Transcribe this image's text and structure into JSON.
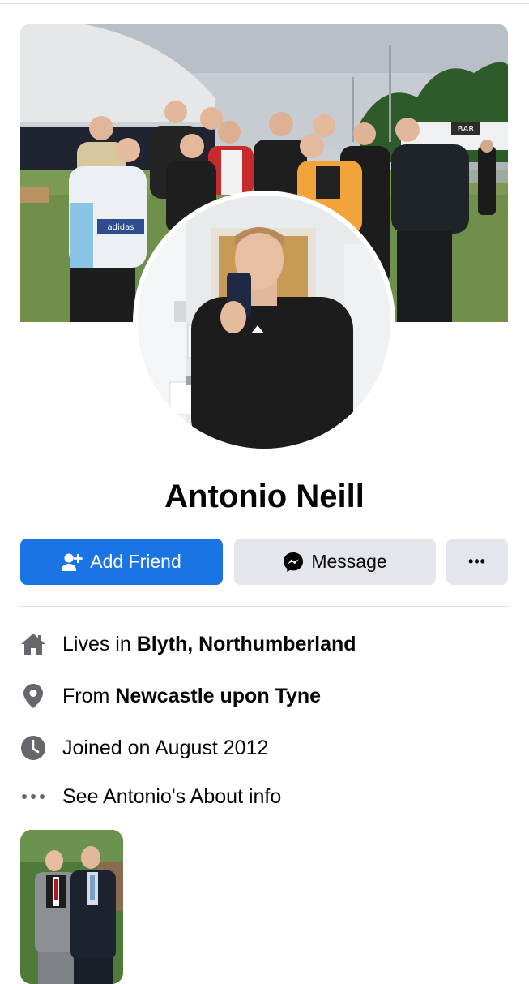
{
  "profile": {
    "name": "Antonio Neill",
    "cover_photo": "cover-photo-group",
    "avatar_photo": "profile-photo-mirror-selfie"
  },
  "actions": {
    "add_friend": {
      "label": "Add Friend",
      "icon": "add-friend-icon"
    },
    "message": {
      "label": "Message",
      "icon": "messenger-icon"
    },
    "more": {
      "label": "•••",
      "icon": "more-icon"
    }
  },
  "info": {
    "lives": {
      "prefix": "Lives in ",
      "value": "Blyth, Northumberland",
      "icon": "home-icon"
    },
    "from": {
      "prefix": "From ",
      "value": "Newcastle upon Tyne",
      "icon": "location-pin-icon"
    },
    "joined": {
      "text": "Joined on August 2012",
      "icon": "clock-icon"
    },
    "about": {
      "text": "See Antonio's About info",
      "icon": "more-dots-icon"
    }
  },
  "cover_sign": "BAR",
  "shirt_brand": "adidas",
  "colors": {
    "primary": "#1b74e4",
    "secondary_button": "#e4e6eb",
    "icon_gray": "#65676b",
    "text": "#050505",
    "divider": "#dadde1"
  }
}
